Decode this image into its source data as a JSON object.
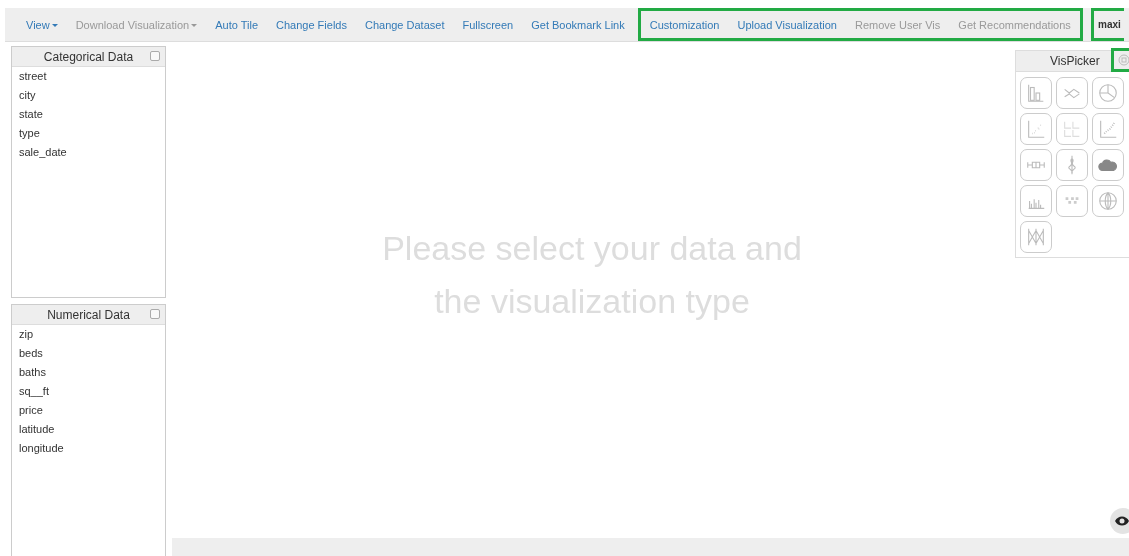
{
  "navbar": {
    "groups": [
      {
        "highlighted": false,
        "items": [
          {
            "label": "View",
            "dropdown": true,
            "disabled": false
          },
          {
            "label": "Download Visualization",
            "dropdown": true,
            "disabled": true
          },
          {
            "label": "Auto Tile",
            "dropdown": false,
            "disabled": false
          },
          {
            "label": "Change Fields",
            "dropdown": false,
            "disabled": false
          },
          {
            "label": "Change Dataset",
            "dropdown": false,
            "disabled": false
          },
          {
            "label": "Fullscreen",
            "dropdown": false,
            "disabled": false
          },
          {
            "label": "Get Bookmark Link",
            "dropdown": false,
            "disabled": false
          }
        ]
      },
      {
        "highlighted": true,
        "items": [
          {
            "label": "Customization",
            "dropdown": false,
            "disabled": false
          },
          {
            "label": "Upload Visualization",
            "dropdown": false,
            "disabled": false
          },
          {
            "label": "Remove User Vis",
            "dropdown": false,
            "disabled": true
          },
          {
            "label": "Get Recommendations",
            "dropdown": false,
            "disabled": true
          }
        ]
      }
    ],
    "user": {
      "label": "maxi",
      "highlighted": true
    }
  },
  "panels": [
    {
      "title": "Categorical Data",
      "checked": false,
      "fields": [
        "street",
        "city",
        "state",
        "type",
        "sale_date"
      ]
    },
    {
      "title": "Numerical Data",
      "checked": false,
      "fields": [
        "zip",
        "beds",
        "baths",
        "sq__ft",
        "price",
        "latitude",
        "longitude"
      ]
    }
  ],
  "canvas": {
    "message_lines": [
      "Please select your data and",
      "the visualization type"
    ]
  },
  "vis_picker": {
    "title": "VisPicker",
    "pin_highlighted": true
  }
}
